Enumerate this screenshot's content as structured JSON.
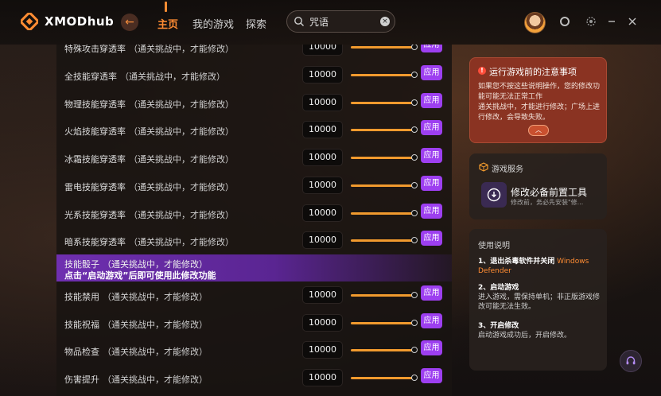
{
  "header": {
    "brand": "XMODhub",
    "nav": {
      "home": "主页",
      "my_games": "我的游戏",
      "explore": "探索"
    },
    "search": {
      "value": "咒语"
    }
  },
  "rows": [
    {
      "label": "特殊攻击穿透率",
      "hint": "（通关挑战中，才能修改）",
      "value": "10000",
      "apply": "应用"
    },
    {
      "label": "全技能穿透率",
      "hint": "（通关挑战中，才能修改）",
      "value": "10000",
      "apply": "应用"
    },
    {
      "label": "物理技能穿透率",
      "hint": "（通关挑战中，才能修改）",
      "value": "10000",
      "apply": "应用"
    },
    {
      "label": "火焰技能穿透率",
      "hint": "（通关挑战中，才能修改）",
      "value": "10000",
      "apply": "应用"
    },
    {
      "label": "冰霜技能穿透率",
      "hint": "（通关挑战中，才能修改）",
      "value": "10000",
      "apply": "应用"
    },
    {
      "label": "雷电技能穿透率",
      "hint": "（通关挑战中，才能修改）",
      "value": "10000",
      "apply": "应用"
    },
    {
      "label": "光系技能穿透率",
      "hint": "（通关挑战中，才能修改）",
      "value": "10000",
      "apply": "应用"
    },
    {
      "label": "暗系技能穿透率",
      "hint": "（通关挑战中，才能修改）",
      "value": "10000",
      "apply": "应用"
    }
  ],
  "highlight_row": {
    "label": "技能骰子",
    "hint": "（通关挑战中，才能修改）",
    "message": "点击“启动游戏”后即可使用此修改功能"
  },
  "rows_bottom": [
    {
      "label": "技能禁用",
      "hint": "（通关挑战中，才能修改）",
      "value": "10000",
      "apply": "应用"
    },
    {
      "label": "技能祝福",
      "hint": "（通关挑战中，才能修改）",
      "value": "10000",
      "apply": "应用"
    },
    {
      "label": "物品检查",
      "hint": "（通关挑战中，才能修改）",
      "value": "10000",
      "apply": "应用"
    },
    {
      "label": "伤害提升",
      "hint": "（通关挑战中，才能修改）",
      "value": "10000",
      "apply": "应用"
    }
  ],
  "notice": {
    "title": "运行游戏前的注意事项",
    "body_1": "如果您不按这些说明操作，您的修改功能可能无法正常工作",
    "body_2": "通关挑战中，才能进行修改；广场上进行修改，会导致失败。",
    "color": "#8a3322"
  },
  "service": {
    "title": "游戏服务",
    "tool_name": "修改必备前置工具",
    "tool_desc": "修改前，务必先安装\"修..."
  },
  "guide": {
    "title": "使用说明",
    "step1_head": "1、退出杀毒软件并关闭",
    "step1_accent": "Windows Defender",
    "step2_head": "2、启动游戏",
    "step2_body": "进入游戏，需保持单机；非正版游戏修改可能无法生效。",
    "step3_head": "3、开启修改",
    "step3_body": "启动游戏成功后，开启修改。"
  },
  "colors": {
    "accent": "#ff8c33",
    "apply": "#9d3ff0",
    "slider": "#f19a2e"
  }
}
